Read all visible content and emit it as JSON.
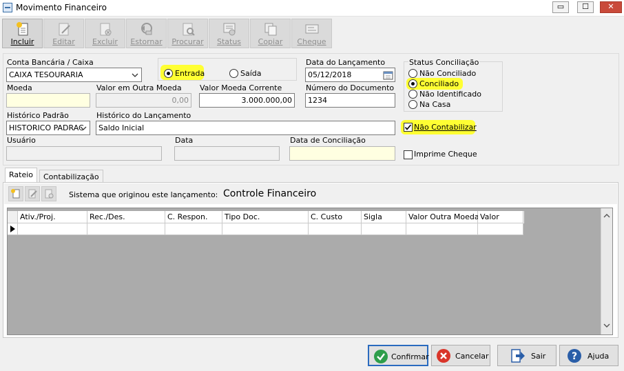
{
  "window": {
    "title": "Movimento Financeiro",
    "minimize": "▭",
    "maximize": "☐",
    "close": "✕"
  },
  "toolbar": [
    {
      "label": "Incluir",
      "enabled": true
    },
    {
      "label": "Editar",
      "enabled": false
    },
    {
      "label": "Excluir",
      "enabled": false
    },
    {
      "label": "Estornar",
      "enabled": false
    },
    {
      "label": "Procurar",
      "enabled": false
    },
    {
      "label": "Status",
      "enabled": false
    },
    {
      "label": "Copiar",
      "enabled": false
    },
    {
      "label": "Cheque",
      "enabled": false
    }
  ],
  "form": {
    "conta_label": "Conta Bancária / Caixa",
    "conta_value": "CAIXA TESOURARIA",
    "tipo": {
      "entrada": "Entrada",
      "saida": "Saída",
      "selected": "Entrada"
    },
    "data_lancamento_label": "Data do Lançamento",
    "data_lancamento_value": "05/12/2018",
    "moeda_label": "Moeda",
    "moeda_value": "",
    "valor_outra_moeda_label": "Valor em Outra Moeda",
    "valor_outra_moeda_value": "0,00",
    "valor_moeda_corrente_label": "Valor Moeda Corrente",
    "valor_moeda_corrente_value": "3.000.000,00",
    "numero_documento_label": "Número do Documento",
    "numero_documento_value": "1234",
    "historico_padrao_label": "Histórico Padrão",
    "historico_padrao_value": "HISTORICO PADRAC",
    "historico_lancamento_label": "Histórico do Lançamento",
    "historico_lancamento_value": "Saldo Inicial",
    "usuario_label": "Usuário",
    "data_label": "Data",
    "data_conciliacao_label": "Data de Conciliação",
    "status_group_label": "Status Conciliação",
    "status_options": [
      "Não Conciliado",
      "Conciliado",
      "Não Identificado",
      "Na Casa"
    ],
    "status_selected": "Conciliado",
    "nao_contabilizar_label": "Não Contabilizar",
    "nao_contabilizar_checked": true,
    "imprime_cheque_label": "Imprime Cheque",
    "imprime_cheque_checked": false
  },
  "tabs": [
    {
      "label": "Rateio",
      "active": true
    },
    {
      "label": "Contabilização",
      "active": false
    }
  ],
  "rateio": {
    "sistema_label": "Sistema que originou este lançamento:",
    "sistema_value": "Controle Financeiro",
    "columns": [
      "Ativ./Proj.",
      "Rec./Des.",
      "C. Respon.",
      "Tipo Doc.",
      "C. Custo",
      "Sigla",
      "Valor Outra Moeda",
      "Valor"
    ]
  },
  "buttons": {
    "confirmar": "Confirmar",
    "cancelar": "Cancelar",
    "sair": "Sair",
    "ajuda": "Ajuda"
  },
  "colors": {
    "highlight": "#ffff33",
    "required_field": "#ffffe1",
    "confirm_border": "#2a6bbf"
  }
}
